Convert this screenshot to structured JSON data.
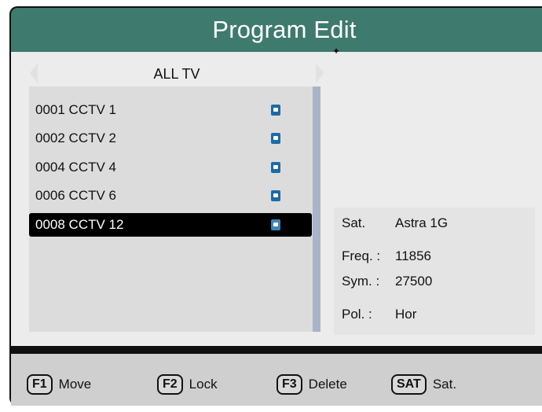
{
  "header": {
    "title": "Program Edit"
  },
  "group": {
    "label": "ALL TV"
  },
  "channels": [
    {
      "label": "0001 CCTV 1",
      "locked": true,
      "selected": false
    },
    {
      "label": "0002 CCTV 2",
      "locked": true,
      "selected": false
    },
    {
      "label": "0004 CCTV 4",
      "locked": true,
      "selected": false
    },
    {
      "label": "0006 CCTV 6",
      "locked": true,
      "selected": false
    },
    {
      "label": "0008 CCTV 12",
      "locked": true,
      "selected": true
    }
  ],
  "info": {
    "sat_label": "Sat.",
    "sat_value": "Astra 1G",
    "freq_label": "Freq. :",
    "freq_value": "11856",
    "sym_label": "Sym. :",
    "sym_value": "27500",
    "pol_label": "Pol. :",
    "pol_value": "Hor"
  },
  "footer": {
    "hints": [
      {
        "key": "F1",
        "label": "Move"
      },
      {
        "key": "F2",
        "label": "Lock"
      },
      {
        "key": "F3",
        "label": "Delete"
      },
      {
        "key": "SAT",
        "label": "Sat."
      }
    ]
  },
  "colors": {
    "title_bg": "#3f7a6e",
    "selected_bg": "#000000",
    "lock_icon": "#1d6aa6"
  }
}
